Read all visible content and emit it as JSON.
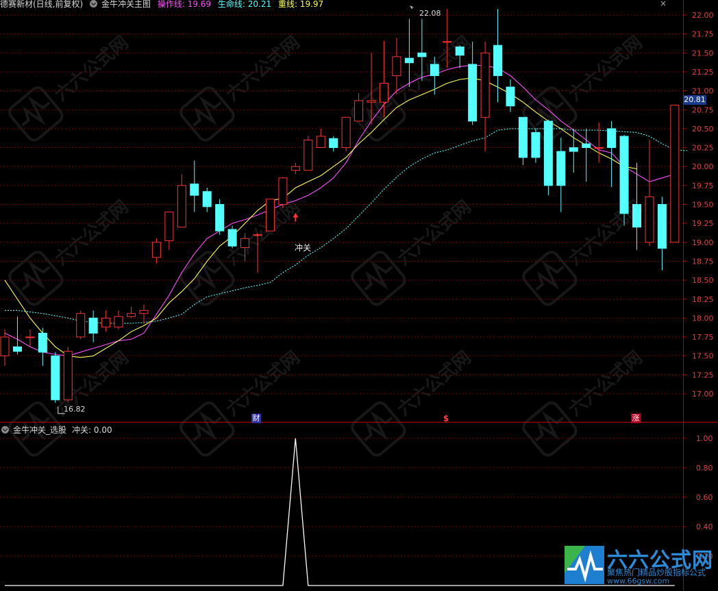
{
  "header_main": {
    "stock": "德赛新材(日线,前复权)",
    "formula": "金牛冲关主图",
    "ops_label": "操作线: 19.69",
    "life_label": "生命线: 20.21",
    "heavy_label": "重线: 19.97",
    "close_glyph": "×"
  },
  "header_sub": {
    "formula": "金牛冲关_选股",
    "value_label": "冲关: 0.00"
  },
  "annotations": {
    "high": "22.08",
    "low": "16.82",
    "signal": "冲关",
    "price_tag": "20.81",
    "badge_cai": "财",
    "badge_dollar": "$",
    "badge_zhang": "涨"
  },
  "watermark": {
    "brand": "六六公式网",
    "slogan": "聚焦热门精品炒股指标公式",
    "url": "www.66gsw.com"
  },
  "colors": {
    "up": "#ff3232",
    "down": "#54ffff",
    "ops": "#ff50ff",
    "life": "#54ffff",
    "heavy": "#ffff54",
    "grid": "#7a0000",
    "axis": "#c00000"
  },
  "chart_data": [
    {
      "type": "candlestick",
      "yaxis_ticks": [
        "22.00",
        "21.75",
        "21.50",
        "21.25",
        "21.00",
        "20.75",
        "20.50",
        "20.25",
        "20.00",
        "19.75",
        "19.50",
        "19.25",
        "19.00",
        "18.75",
        "18.50",
        "18.25",
        "18.00",
        "17.75",
        "17.50",
        "17.25",
        "17.00"
      ],
      "ylim": [
        16.7,
        22.2
      ],
      "candles": [
        [
          17.5,
          17.75,
          17.37,
          17.85
        ],
        [
          17.62,
          17.56,
          17.52,
          18.02
        ],
        [
          17.75,
          17.75,
          17.62,
          17.85
        ],
        [
          17.8,
          17.55,
          17.37,
          17.87
        ],
        [
          17.5,
          16.92,
          16.88,
          17.55
        ],
        [
          16.92,
          17.56,
          16.88,
          17.62
        ],
        [
          17.75,
          18.06,
          17.72,
          18.1
        ],
        [
          18.0,
          17.8,
          17.68,
          18.1
        ],
        [
          17.88,
          18.0,
          17.82,
          18.1
        ],
        [
          17.88,
          18.02,
          17.85,
          18.1
        ],
        [
          18.02,
          18.06,
          18.0,
          18.15
        ],
        [
          18.06,
          18.1,
          17.92,
          18.18
        ],
        [
          18.8,
          19.0,
          18.72,
          19.05
        ],
        [
          19.02,
          19.4,
          18.9,
          19.4
        ],
        [
          19.2,
          19.75,
          19.2,
          19.9
        ],
        [
          19.77,
          19.62,
          19.4,
          20.08
        ],
        [
          19.67,
          19.47,
          19.4,
          19.72
        ],
        [
          19.5,
          19.15,
          19.1,
          19.57
        ],
        [
          19.17,
          18.95,
          18.92,
          19.22
        ],
        [
          18.93,
          19.05,
          18.75,
          19.12
        ],
        [
          19.1,
          19.1,
          18.6,
          19.12
        ],
        [
          19.15,
          19.57,
          19.15,
          19.57
        ],
        [
          19.5,
          19.85,
          19.45,
          19.86
        ],
        [
          19.95,
          20.0,
          19.9,
          20.05
        ],
        [
          19.95,
          20.35,
          19.95,
          20.4
        ],
        [
          20.25,
          20.4,
          20.25,
          20.5
        ],
        [
          20.37,
          20.25,
          20.2,
          20.4
        ],
        [
          20.25,
          20.65,
          20.2,
          20.65
        ],
        [
          20.6,
          20.87,
          20.6,
          20.97
        ],
        [
          20.85,
          20.87,
          20.55,
          21.5
        ],
        [
          20.85,
          21.1,
          20.65,
          21.66
        ],
        [
          21.2,
          21.45,
          20.95,
          21.7
        ],
        [
          21.43,
          21.37,
          21.05,
          21.95
        ],
        [
          21.5,
          21.45,
          21.13,
          21.95
        ],
        [
          21.35,
          21.2,
          20.95,
          21.45
        ],
        [
          21.65,
          21.65,
          21.3,
          22.08
        ],
        [
          21.58,
          21.47,
          21.3,
          21.6
        ],
        [
          21.35,
          20.6,
          20.55,
          21.65
        ],
        [
          20.65,
          21.5,
          20.2,
          21.65
        ],
        [
          21.6,
          21.2,
          20.85,
          22.08
        ],
        [
          21.05,
          20.8,
          20.72,
          21.15
        ],
        [
          20.65,
          20.12,
          20.02,
          20.65
        ],
        [
          20.45,
          20.12,
          20.05,
          20.5
        ],
        [
          20.6,
          19.75,
          19.62,
          20.62
        ],
        [
          20.2,
          19.75,
          19.4,
          20.38
        ],
        [
          20.25,
          20.2,
          19.92,
          20.5
        ],
        [
          20.3,
          20.25,
          19.8,
          20.5
        ],
        [
          20.25,
          20.25,
          20.05,
          20.58
        ],
        [
          20.5,
          20.25,
          19.73,
          20.6
        ],
        [
          20.4,
          19.38,
          19.22,
          20.42
        ],
        [
          19.5,
          19.2,
          18.9,
          20.05
        ],
        [
          19.0,
          19.6,
          18.95,
          20.35
        ],
        [
          19.5,
          18.92,
          18.63,
          19.6
        ],
        [
          19.0,
          20.81,
          19.0,
          20.81
        ]
      ],
      "series": [
        {
          "name": "操作线",
          "values": [
            17.8,
            17.72,
            17.62,
            17.55,
            17.52,
            17.5,
            17.55,
            17.6,
            17.65,
            17.7,
            17.72,
            17.8,
            18.05,
            18.3,
            18.6,
            18.85,
            19.05,
            19.15,
            19.25,
            19.3,
            19.36,
            19.43,
            19.5,
            19.55,
            19.62,
            19.72,
            19.85,
            20.05,
            20.35,
            20.6,
            20.82,
            21.0,
            21.1,
            21.18,
            21.22,
            21.28,
            21.32,
            21.34,
            21.33,
            21.3,
            21.2,
            21.05,
            20.88,
            20.75,
            20.6,
            20.48,
            20.35,
            20.22,
            20.18,
            20.0,
            19.9,
            19.8,
            19.85,
            19.9
          ]
        },
        {
          "name": "生命线",
          "values": [
            18.1,
            18.1,
            18.08,
            18.06,
            18.03,
            18.0,
            17.96,
            17.94,
            17.93,
            17.93,
            17.93,
            17.94,
            17.96,
            18.0,
            18.05,
            18.18,
            18.28,
            18.32,
            18.36,
            18.4,
            18.43,
            18.47,
            18.6,
            18.7,
            18.83,
            18.93,
            19.05,
            19.18,
            19.35,
            19.52,
            19.7,
            19.86,
            20.0,
            20.1,
            20.18,
            20.22,
            20.28,
            20.34,
            20.38,
            20.48,
            20.5,
            20.5,
            20.5,
            20.5,
            20.5,
            20.48,
            20.48,
            20.48,
            20.47,
            20.46,
            20.45,
            20.4,
            20.3,
            20.22,
            20.21
          ]
        },
        {
          "name": "重线",
          "values": [
            18.5,
            18.25,
            18.0,
            17.8,
            17.62,
            17.5,
            17.48,
            17.5,
            17.6,
            17.7,
            17.82,
            17.9,
            18.0,
            18.2,
            18.35,
            18.52,
            18.75,
            18.95,
            19.08,
            19.25,
            19.42,
            19.55,
            19.58,
            19.72,
            19.8,
            19.88,
            20.0,
            20.12,
            20.3,
            20.45,
            20.62,
            20.78,
            20.88,
            20.95,
            21.02,
            21.1,
            21.15,
            21.17,
            21.13,
            21.05,
            20.96,
            20.85,
            20.72,
            20.6,
            20.5,
            20.38,
            20.28,
            20.18,
            20.1,
            20.0,
            19.97
          ]
        }
      ]
    },
    {
      "type": "line",
      "yaxis_ticks": [
        "1.00",
        "0.80",
        "0.60",
        "0.40",
        "0.20"
      ],
      "ylim": [
        0,
        1
      ],
      "series": [
        {
          "name": "冲关",
          "values": [
            0,
            0,
            0,
            0,
            0,
            0,
            0,
            0,
            0,
            0,
            0,
            0,
            0,
            0,
            0,
            0,
            0,
            0,
            0,
            0,
            0,
            0,
            0,
            1,
            0,
            0,
            0,
            0,
            0,
            0,
            0,
            0,
            0,
            0,
            0,
            0,
            0,
            0,
            0,
            0,
            0,
            0,
            0,
            0,
            0,
            0,
            0,
            0,
            0,
            0,
            0,
            0,
            0,
            0
          ]
        }
      ]
    }
  ]
}
